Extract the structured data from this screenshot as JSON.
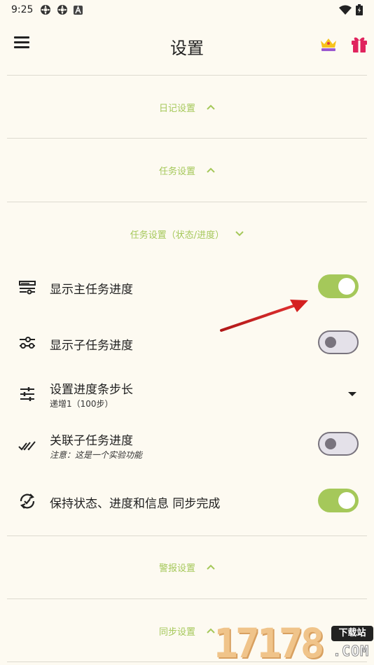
{
  "status_bar": {
    "time": "9:25",
    "left_icons": [
      "settings-sync-icon",
      "settings-sync-icon",
      "a-badge-icon"
    ],
    "right_icons": [
      "wifi-icon",
      "battery-icon"
    ]
  },
  "header": {
    "title": "设置",
    "menu_icon": "hamburger-menu-icon",
    "premium_icon": "crown-icon",
    "gift_icon": "gift-icon"
  },
  "sections": {
    "diary": {
      "label": "日记设置",
      "state": "collapsed"
    },
    "task": {
      "label": "任务设置",
      "state": "collapsed"
    },
    "task_status": {
      "label": "任务设置（状态/进度）",
      "state": "expanded"
    },
    "alarm": {
      "label": "警报设置",
      "state": "collapsed"
    },
    "sync": {
      "label": "同步设置",
      "state": "collapsed"
    }
  },
  "settings": [
    {
      "label": "显示主任务进度",
      "icon": "progress-bar-icon",
      "control": "toggle",
      "on": true
    },
    {
      "label": "显示子任务进度",
      "icon": "sub-progress-icon",
      "control": "toggle",
      "on": false
    },
    {
      "label": "设置进度条步长",
      "sub": "递增1（100步）",
      "icon": "tune-sliders-icon",
      "control": "dropdown"
    },
    {
      "label": "关联子任务进度",
      "sub": "注意：这是一个实验功能",
      "icon": "double-check-icon",
      "control": "toggle",
      "on": false
    },
    {
      "label": "保持状态、进度和信息 同步完成",
      "icon": "sync-check-icon",
      "control": "toggle",
      "on": true
    }
  ],
  "watermark": {
    "digits": "17178",
    "badge": "下载站",
    "domain": ".COM"
  },
  "colors": {
    "accent": "#a5c85a",
    "background": "#fdfaf1",
    "divider": "#dddad0",
    "arrow": "#d42020"
  }
}
